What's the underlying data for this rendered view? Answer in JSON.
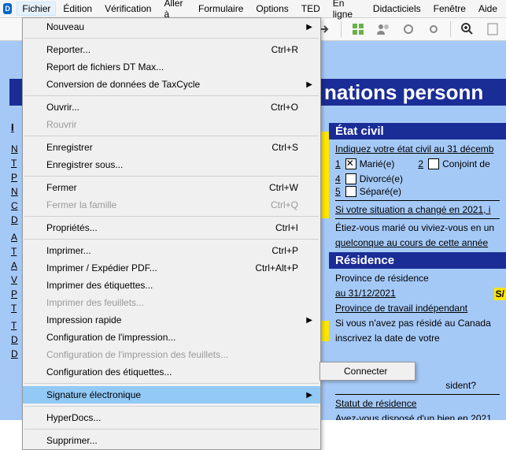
{
  "menubar": {
    "items": [
      "Fichier",
      "Édition",
      "Vérification",
      "Aller à",
      "Formulaire",
      "Options",
      "TED",
      "En ligne",
      "Didacticiels",
      "Fenêtre",
      "Aide"
    ],
    "open_index": 0
  },
  "file_menu": {
    "nouveau": "Nouveau",
    "reporter": "Reporter...",
    "reporter_sc": "Ctrl+R",
    "report_dtmax": "Report de fichiers DT Max...",
    "conversion": "Conversion de données de TaxCycle",
    "ouvrir": "Ouvrir...",
    "ouvrir_sc": "Ctrl+O",
    "rouvrir": "Rouvrir",
    "enregistrer": "Enregistrer",
    "enregistrer_sc": "Ctrl+S",
    "enregistrer_sous": "Enregistrer sous...",
    "fermer": "Fermer",
    "fermer_sc": "Ctrl+W",
    "fermer_famille": "Fermer la famille",
    "fermer_famille_sc": "Ctrl+Q",
    "proprietes": "Propriétés...",
    "proprietes_sc": "Ctrl+I",
    "imprimer": "Imprimer...",
    "imprimer_sc": "Ctrl+P",
    "imprimer_pdf": "Imprimer / Expédier PDF...",
    "imprimer_pdf_sc": "Ctrl+Alt+P",
    "imprimer_etiquettes": "Imprimer des étiquettes...",
    "imprimer_feuillets": "Imprimer des feuillets...",
    "impression_rapide": "Impression rapide",
    "config_impression": "Configuration de l'impression...",
    "config_imp_feuillets": "Configuration de l'impression des feuillets...",
    "config_etiquettes": "Configuration des étiquettes...",
    "signature": "Signature électronique",
    "hyperdocs": "HyperDocs...",
    "supprimer": "Supprimer..."
  },
  "submenu": {
    "connecter": "Connecter"
  },
  "banner_title": "nations personn",
  "form": {
    "i_header": "I",
    "letters": [
      "N",
      "T",
      "P",
      "N",
      "C",
      "D",
      "",
      "A",
      "T",
      "A",
      "V",
      "P",
      "T",
      "",
      "T",
      "D",
      "D"
    ],
    "etat_civil": {
      "title": "État civil",
      "prompt": "Indiquez votre état civil au 31 décemb",
      "opt1_num": "1",
      "opt1": "Marié(e)",
      "opt2_num": "2",
      "opt2": "Conjoint de",
      "opt4_num": "4",
      "opt4": "Divorcé(e)",
      "opt5_num": "5",
      "opt5": "Séparé(e)",
      "change": "Si votre situation a changé en 2021, i",
      "q1a": "Étiez-vous marié ou viviez-vous en un",
      "q1b": "quelconque au cours de cette année"
    },
    "residence": {
      "title": "Résidence",
      "l1": "Province de résidence",
      "l2": "au 31/12/2021",
      "so": "S/",
      "l3": "Province de travail indépendant",
      "l4": "Si vous n'avez pas résidé au Canada",
      "l5": "inscrivez la date de votre",
      "q": "sident?",
      "statut": "Statut de résidence",
      "bien": "Avez-vous disposé d'un bien en 2021"
    }
  }
}
